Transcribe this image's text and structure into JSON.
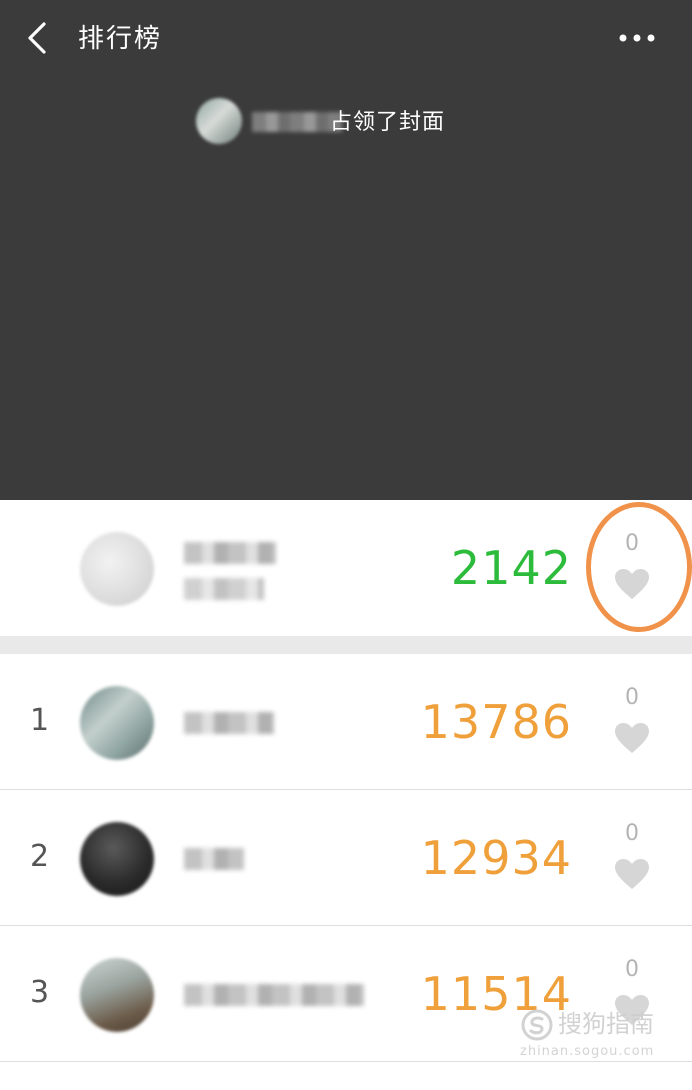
{
  "header": {
    "title": "排行榜",
    "back_icon": "chevron-left-icon",
    "more_icon": "more-horizontal-icon"
  },
  "cover": {
    "notice_text": "占领了封面"
  },
  "my_entry": {
    "steps": "2142",
    "likes": "0",
    "steps_color": "#2dbb3c"
  },
  "ranking": [
    {
      "rank": "1",
      "steps": "13786",
      "likes": "0"
    },
    {
      "rank": "2",
      "steps": "12934",
      "likes": "0"
    },
    {
      "rank": "3",
      "steps": "11514",
      "likes": "0"
    }
  ],
  "colors": {
    "cover_bg": "#3b3b3b",
    "rank_steps": "#f0a03a",
    "highlight_ring": "#f0924a",
    "heart": "#d6d6d6"
  },
  "watermark": {
    "text": "搜狗指南",
    "sub": "zhinan.sogou.com"
  }
}
